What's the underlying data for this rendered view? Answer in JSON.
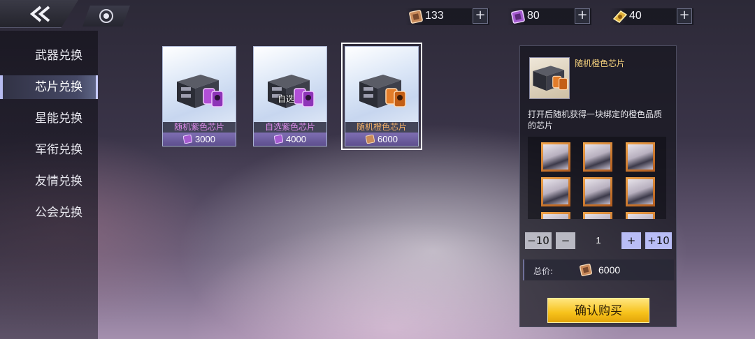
{
  "nav": {
    "back_icon": "double-chevron-left-icon",
    "home_icon": "ring-icon"
  },
  "currencies": [
    {
      "icon": "card-ticket-icon",
      "value": "133",
      "color": "#c98a5a"
    },
    {
      "icon": "purple-ticket-icon",
      "value": "80",
      "color": "#a65bd1"
    },
    {
      "icon": "gold-ticket-icon",
      "value": "40",
      "color": "#e2b13a"
    }
  ],
  "plus_label": "+",
  "sidebar": {
    "items": [
      {
        "label": "武器兑换"
      },
      {
        "label": "芯片兑换",
        "active": true
      },
      {
        "label": "星能兑换"
      },
      {
        "label": "军衔兑换"
      },
      {
        "label": "友情兑换"
      },
      {
        "label": "公会兑换"
      }
    ]
  },
  "cards": [
    {
      "name": "随机紫色芯片",
      "price": "3000",
      "name_color": "#e38ef0",
      "accent": "#b14fd6"
    },
    {
      "name": "自选紫色芯片",
      "price": "4000",
      "name_color": "#e38ef0",
      "accent": "#b14fd6",
      "tag": "自选"
    },
    {
      "name": "随机橙色芯片",
      "price": "6000",
      "name_color": "#f3b16a",
      "accent": "#e37d2a",
      "selected": true
    }
  ],
  "detail": {
    "title": "随机橙色芯片",
    "description": "打开后随机获得一块绑定的橙色品质的芯片",
    "quantity": "1",
    "minus10": "−10",
    "minus1": "−",
    "plus1": "+",
    "plus10": "+10",
    "total_label": "总价:",
    "total_value": "6000",
    "buy_label": "确认购买"
  },
  "colors": {
    "accent_gold": "#f7c21b",
    "title_orange": "#f6d27e"
  }
}
